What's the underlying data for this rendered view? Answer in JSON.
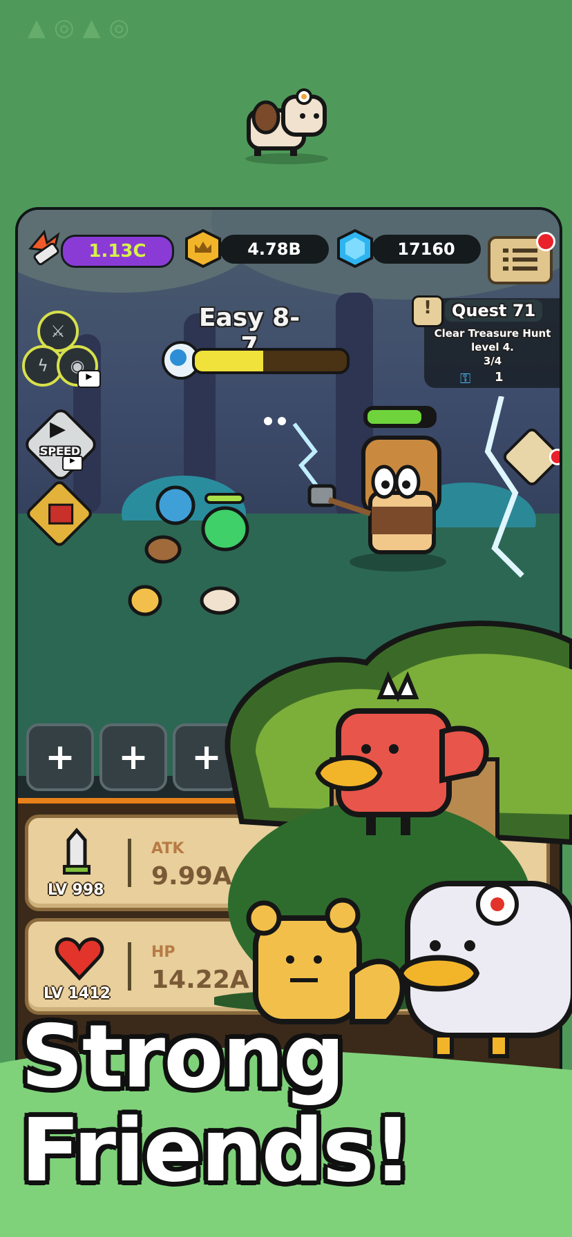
{
  "hud": {
    "power_value": "1.13C",
    "gold_value": "4.78B",
    "gem_value": "17160"
  },
  "stage": {
    "title": "Easy 8-7",
    "progress": 0.45
  },
  "quest": {
    "title": "Quest 71",
    "line1": "Clear Treasure Hunt",
    "line2": "level 4.",
    "progress": "3/4",
    "reward_count": "1"
  },
  "speed_label": "SPEED",
  "slots": [
    "+",
    "+",
    "+"
  ],
  "stats": [
    {
      "label": "ATK",
      "value": "9.99A",
      "level": "LV 998"
    },
    {
      "label": "HP",
      "value": "14.22A",
      "level": "LV 1412"
    }
  ],
  "promo": {
    "line1": "Strong",
    "line2": "Friends!"
  },
  "colors": {
    "background": "#4f9a5a",
    "power_bar": "#8a3bd6",
    "power_text": "#d6f24a",
    "progress_fill": "#f0e23a",
    "enemy_hp": "#6fd43c",
    "panel": "#e8cf9b"
  }
}
